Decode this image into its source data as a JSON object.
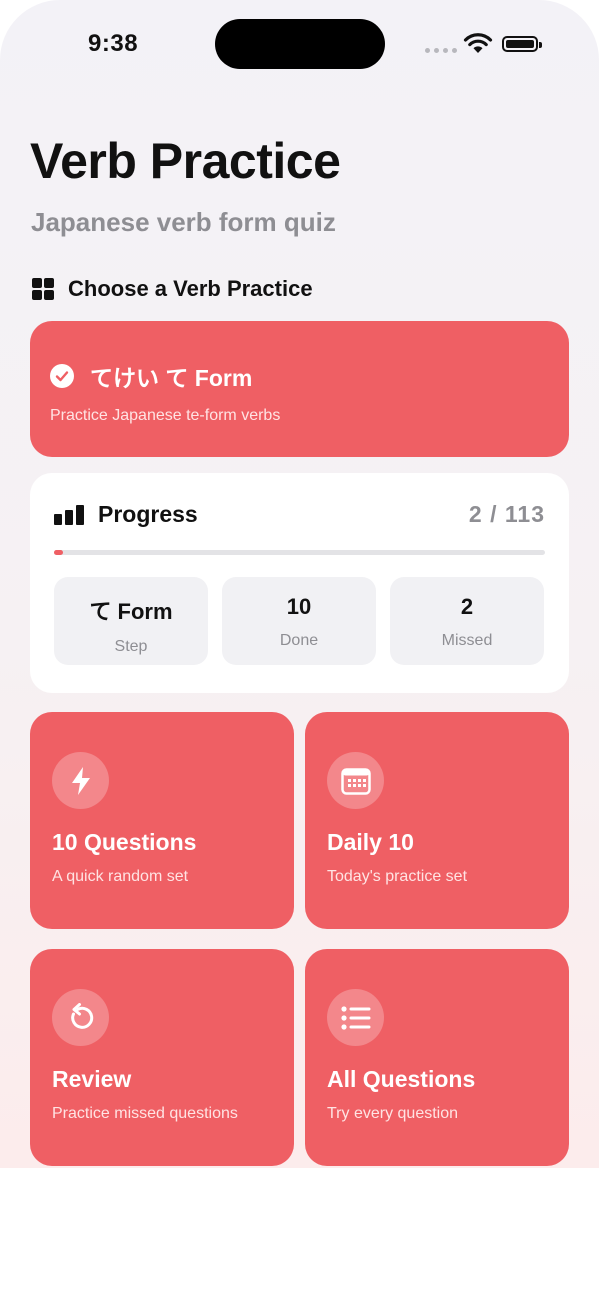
{
  "status_bar": {
    "time": "9:38"
  },
  "header": {
    "title": "Verb Practice",
    "subtitle": "Japanese verb form quiz"
  },
  "section": {
    "label": "Choose a Verb Practice",
    "icon": "grid-icon"
  },
  "selected_practice": {
    "title": "てけい て Form",
    "description": "Practice Japanese te-form verbs",
    "icon": "checkmark-circle-icon"
  },
  "progress": {
    "title": "Progress",
    "count": "2 / 113",
    "fraction": 0.018,
    "stats": [
      {
        "value": "て Form",
        "label": "Step"
      },
      {
        "value": "10",
        "label": "Done"
      },
      {
        "value": "2",
        "label": "Missed"
      }
    ]
  },
  "modes": [
    {
      "title": "10 Questions",
      "subtitle": "A quick random set",
      "icon": "lightning-icon"
    },
    {
      "title": "Daily 10",
      "subtitle": "Today's practice set",
      "icon": "calendar-icon"
    },
    {
      "title": "Review",
      "subtitle": "Practice missed questions",
      "icon": "retry-icon"
    },
    {
      "title": "All Questions",
      "subtitle": "Try every question",
      "icon": "list-icon"
    }
  ],
  "colors": {
    "accent": "#ef5f64",
    "background": "#f3f2f7",
    "secondary_text": "#8e8e93"
  }
}
